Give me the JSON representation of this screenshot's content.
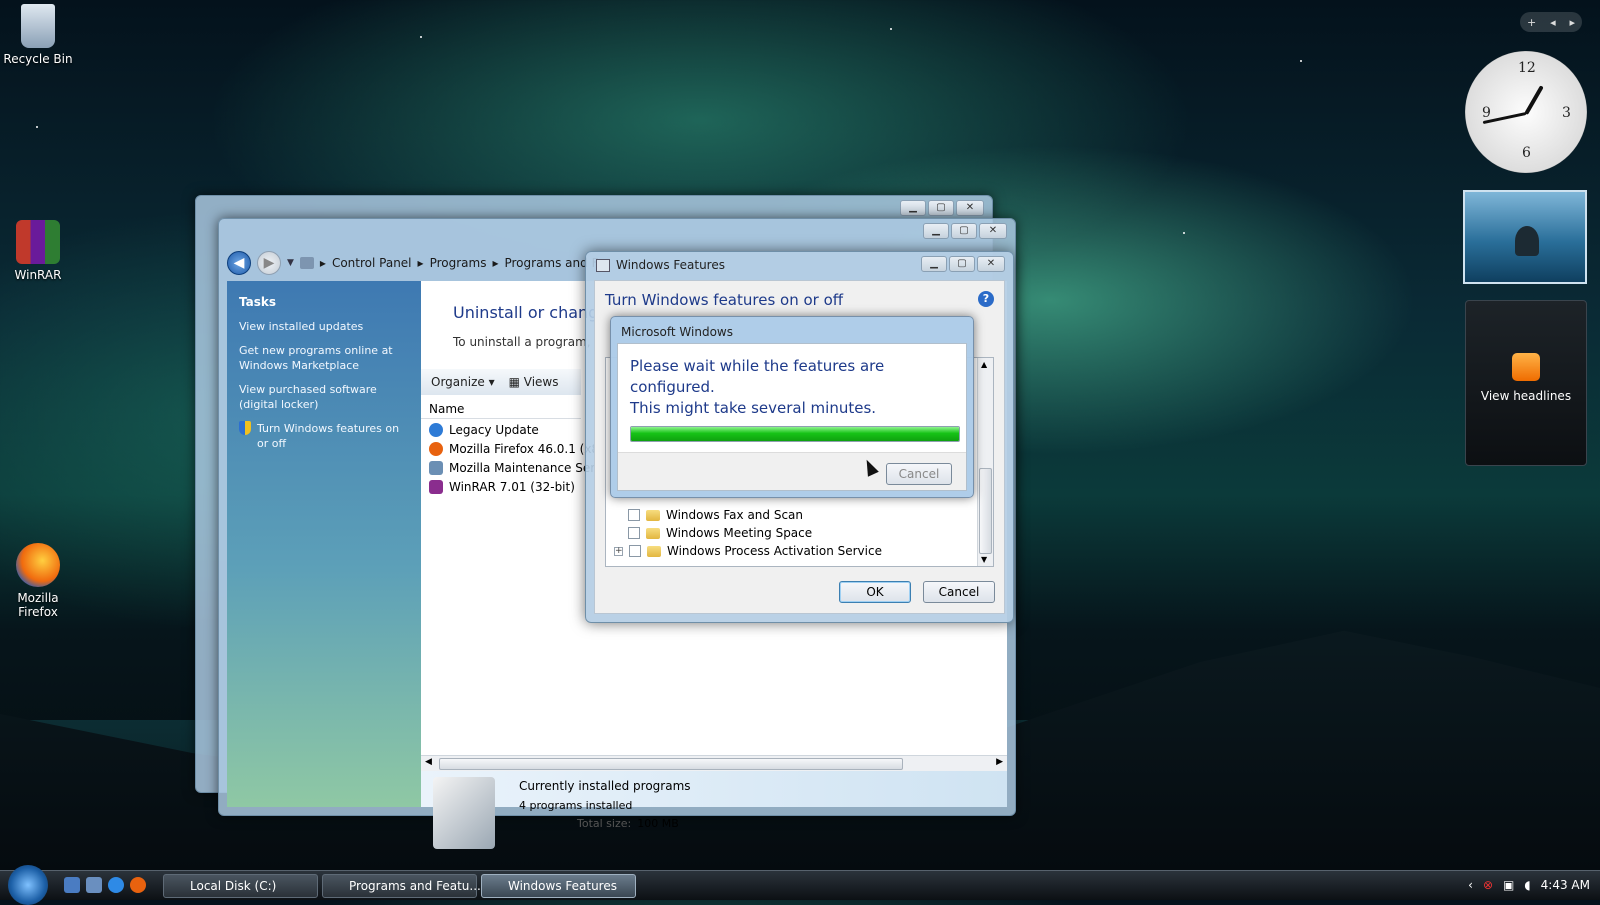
{
  "desktop": {
    "icons": [
      {
        "label": "Recycle Bin",
        "icon": "recycle-bin-icon"
      },
      {
        "label": "WinRAR",
        "icon": "winrar-icon"
      },
      {
        "label": "Mozilla Firefox",
        "icon": "firefox-icon"
      }
    ]
  },
  "explorer": {
    "title_buttons": [
      "minimize",
      "maximize",
      "close"
    ],
    "breadcrumb": [
      "Control Panel",
      "Programs",
      "Programs and F"
    ],
    "tasks": {
      "title": "Tasks",
      "links": [
        "View installed updates",
        "Get new programs online at Windows Marketplace",
        "View purchased software (digital locker)",
        "Turn Windows features on or off"
      ]
    },
    "heading": "Uninstall or chang",
    "subheading": "To uninstall a program,",
    "toolbar": {
      "organize": "Organize",
      "views": "Views"
    },
    "column_name": "Name",
    "programs": [
      {
        "name": "Legacy Update",
        "color": "#2e7bd6"
      },
      {
        "name": "Mozilla Firefox 46.0.1 (x86",
        "color": "#e8620f"
      },
      {
        "name": "Mozilla Maintenance Serv",
        "color": "#6b8fb4"
      },
      {
        "name": "WinRAR 7.01 (32-bit)",
        "color": "#8a2d8e"
      }
    ],
    "details": {
      "title": "Currently installed programs",
      "count": "4 programs installed",
      "size_label": "Total size:",
      "size_value": "100 MB"
    }
  },
  "features_dialog": {
    "title": "Windows Features",
    "heading": "Turn Windows features on or off",
    "help": "?",
    "items": [
      {
        "label": "Windows Fax and Scan",
        "expandable": false
      },
      {
        "label": "Windows Meeting Space",
        "expandable": false
      },
      {
        "label": "Windows Process Activation Service",
        "expandable": true
      }
    ],
    "ok": "OK",
    "cancel": "Cancel"
  },
  "progress_dialog": {
    "title": "Microsoft Windows",
    "message_line1": "Please wait while the features are configured.",
    "message_line2": "This might take several minutes.",
    "progress": 1.0,
    "cancel": "Cancel"
  },
  "gadgets": {
    "clock_time": "4:43",
    "feed_label": "View headlines"
  },
  "taskbar": {
    "tasks": [
      {
        "label": "Local Disk (C:)",
        "active": false
      },
      {
        "label": "Programs and Featu...",
        "active": false
      },
      {
        "label": "Windows Features",
        "active": true
      }
    ],
    "clock": "4:43 AM"
  }
}
